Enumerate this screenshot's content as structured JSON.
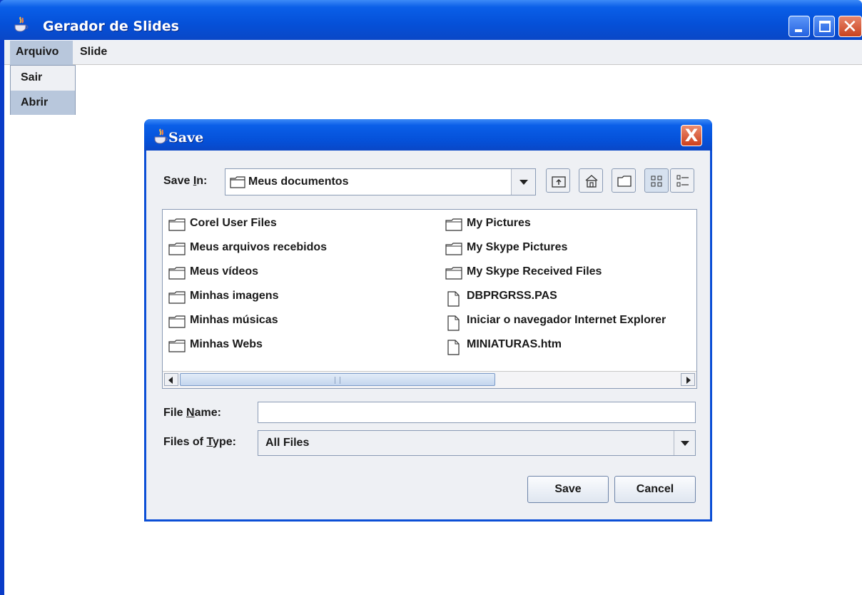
{
  "window": {
    "title": "Gerador de Slides",
    "icon": "java-cup-icon"
  },
  "menubar": {
    "items": [
      {
        "label": "Arquivo"
      },
      {
        "label": "Slide"
      }
    ]
  },
  "dropdown": {
    "items": [
      {
        "label": "Sair"
      },
      {
        "label": "Abrir"
      }
    ]
  },
  "dialog": {
    "title": "Save",
    "close_glyph": "X",
    "save_in_label_prefix": "Save ",
    "save_in_label_mnemonic": "I",
    "save_in_label_suffix": "n:",
    "save_in_value": "Meus documentos",
    "toolbar": [
      "up-folder-icon",
      "home-icon",
      "new-folder-icon",
      "list-view-icon",
      "details-view-icon"
    ],
    "files_left": [
      {
        "name": "Corel User Files",
        "type": "folder"
      },
      {
        "name": "Meus arquivos recebidos",
        "type": "folder"
      },
      {
        "name": "Meus vídeos",
        "type": "folder"
      },
      {
        "name": "Minhas imagens",
        "type": "folder"
      },
      {
        "name": "Minhas músicas",
        "type": "folder"
      },
      {
        "name": "Minhas Webs",
        "type": "folder"
      }
    ],
    "files_right": [
      {
        "name": "My Pictures",
        "type": "folder"
      },
      {
        "name": "My Skype Pictures",
        "type": "folder"
      },
      {
        "name": "My Skype Received Files",
        "type": "folder"
      },
      {
        "name": "DBPRGRSS.PAS",
        "type": "file"
      },
      {
        "name": "Iniciar o navegador Internet Explorer",
        "type": "file"
      },
      {
        "name": "MINIATURAS.htm",
        "type": "file"
      }
    ],
    "file_name_label_prefix": "File ",
    "file_name_label_mnemonic": "N",
    "file_name_label_suffix": "ame:",
    "file_name_value": "",
    "file_type_label_prefix": "Files of ",
    "file_type_label_mnemonic": "T",
    "file_type_label_suffix": "ype:",
    "file_type_value": "All Files",
    "save_button": "Save",
    "cancel_button": "Cancel"
  },
  "colors": {
    "titlebar": "#0550d8",
    "menu_highlight": "#b8c7dc",
    "panel": "#eef0f4"
  }
}
